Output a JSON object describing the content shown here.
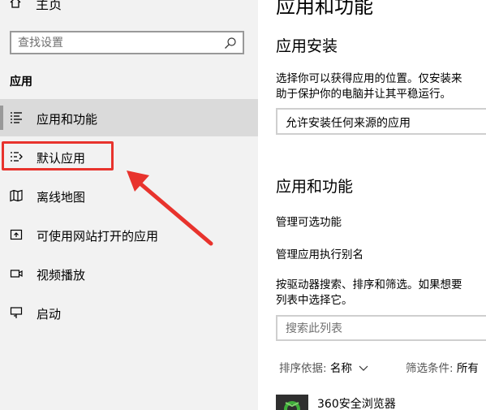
{
  "sidebar": {
    "home_label": "主页",
    "search_placeholder": "查找设置",
    "section_label": "应用",
    "items": [
      {
        "label": "应用和功能",
        "icon": "apps-features-icon"
      },
      {
        "label": "默认应用",
        "icon": "default-apps-icon"
      },
      {
        "label": "离线地图",
        "icon": "offline-maps-icon"
      },
      {
        "label": "可使用网站打开的应用",
        "icon": "apps-for-websites-icon"
      },
      {
        "label": "视频播放",
        "icon": "video-playback-icon"
      },
      {
        "label": "启动",
        "icon": "startup-icon"
      }
    ],
    "selected_index": 0
  },
  "annotation": {
    "color": "#e8332d",
    "highlighted_item": "默认应用"
  },
  "main": {
    "page_title": "应用和功能",
    "install_heading": "应用安装",
    "install_desc_line1": "选择你可以获得应用的位置。仅安装来",
    "install_desc_line2": "助于保护你的电脑并让其平稳运行。",
    "install_select_value": "允许安装任何来源的应用",
    "apps_heading": "应用和功能",
    "link_optional_features": "管理可选功能",
    "link_app_aliases": "管理应用执行别名",
    "filter_desc_line1": "按驱动器搜索、排序和筛选。如果想要",
    "filter_desc_line2": "列表中选择它。",
    "search_list_placeholder": "搜索此列表",
    "sort_label": "排序依据:",
    "sort_value": "名称",
    "filter_label": "筛选条件:",
    "filter_value": "所有",
    "app_name": "360安全浏览器",
    "app_icon": "360-browser-icon"
  }
}
